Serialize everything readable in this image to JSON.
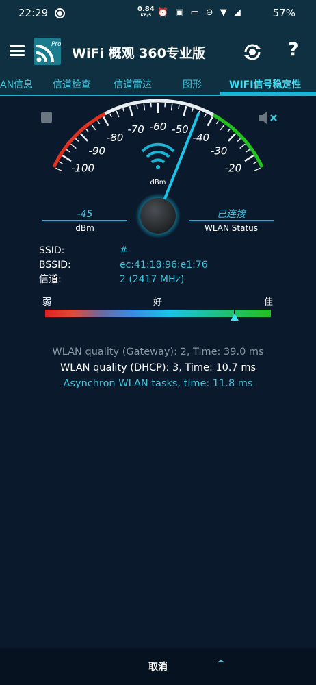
{
  "status_bar": {
    "time": "22:29",
    "net_speed": "0.84",
    "net_unit": "KB/S",
    "battery": "57%"
  },
  "app": {
    "title": "WiFi 概观 360专业版",
    "logo_badge": "Pro"
  },
  "tabs": [
    {
      "label": "AN信息"
    },
    {
      "label": "信道检查"
    },
    {
      "label": "信道雷达"
    },
    {
      "label": "图形"
    },
    {
      "label": "WIFI信号稳定性",
      "active": true
    }
  ],
  "gauge": {
    "ticks": [
      "-100",
      "-90",
      "-80",
      "-70",
      "-60",
      "-50",
      "-40",
      "-30",
      "-20"
    ],
    "unit": "dBm",
    "current_dbm": -45,
    "signal_label": "-45",
    "signal_unit": "dBm",
    "status_value": "已连接",
    "status_label": "WLAN Status"
  },
  "info": {
    "ssid_label": "SSID:",
    "ssid_value": "#",
    "bssid_label": "BSSID:",
    "bssid_value": "ec:41:18:96:e1:76",
    "channel_label": "信道:",
    "channel_value": "2 (2417 MHz)"
  },
  "quality": {
    "weak": "弱",
    "good": "好",
    "excellent": "佳",
    "level": 0.84
  },
  "messages": {
    "gateway": "WLAN quality (Gateway): 2, Time: 39.0 ms",
    "dhcp": "WLAN quality (DHCP): 3, Time: 10.7 ms",
    "async": "Asynchron WLAN tasks, time: 11.8 ms"
  },
  "bottom": {
    "cancel": "取消"
  },
  "colors": {
    "accent": "#1cb4d4",
    "red_arc": "#e03020",
    "green_arc": "#22c020"
  }
}
